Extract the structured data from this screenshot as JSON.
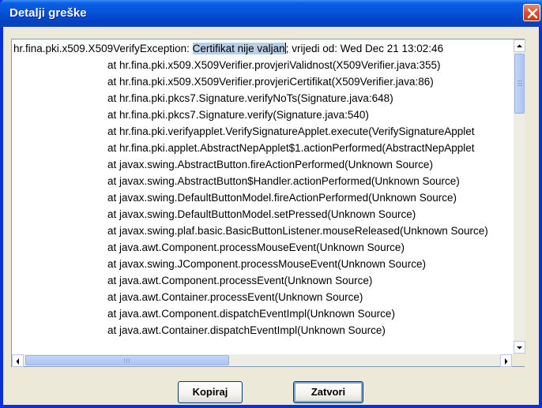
{
  "window": {
    "title": "Detalji greške",
    "close_icon": "close-icon"
  },
  "trace": {
    "first_line_prefix": "hr.fina.pki.x509.X509VerifyException: ",
    "first_line_selected": "Certifikat nije valjan",
    "first_line_suffix": "; vrijedi od: Wed Dec 21 13:02:46",
    "lines": [
      "at hr.fina.pki.x509.X509Verifier.provjeriValidnost(X509Verifier.java:355)",
      "at hr.fina.pki.x509.X509Verifier.provjeriCertifikat(X509Verifier.java:86)",
      "at hr.fina.pki.pkcs7.Signature.verifyNoTs(Signature.java:648)",
      "at hr.fina.pki.pkcs7.Signature.verify(Signature.java:540)",
      "at hr.fina.pki.verifyapplet.VerifySignatureApplet.execute(VerifySignatureApplet",
      "at hr.fina.pki.applet.AbstractNepApplet$1.actionPerformed(AbstractNepApplet",
      "at javax.swing.AbstractButton.fireActionPerformed(Unknown Source)",
      "at javax.swing.AbstractButton$Handler.actionPerformed(Unknown Source)",
      "at javax.swing.DefaultButtonModel.fireActionPerformed(Unknown Source)",
      "at javax.swing.DefaultButtonModel.setPressed(Unknown Source)",
      "at javax.swing.plaf.basic.BasicButtonListener.mouseReleased(Unknown Source)",
      "at java.awt.Component.processMouseEvent(Unknown Source)",
      "at javax.swing.JComponent.processMouseEvent(Unknown Source)",
      "at java.awt.Component.processEvent(Unknown Source)",
      "at java.awt.Container.processEvent(Unknown Source)",
      "at java.awt.Component.dispatchEventImpl(Unknown Source)",
      "at java.awt.Container.dispatchEventImpl(Unknown Source)"
    ]
  },
  "buttons": {
    "copy_label": "Kopiraj",
    "close_label": "Zatvori"
  },
  "colors": {
    "titlebar": "#0553d8",
    "selection": "#b8cfe5",
    "scroll_thumb": "#b9cdf7"
  }
}
